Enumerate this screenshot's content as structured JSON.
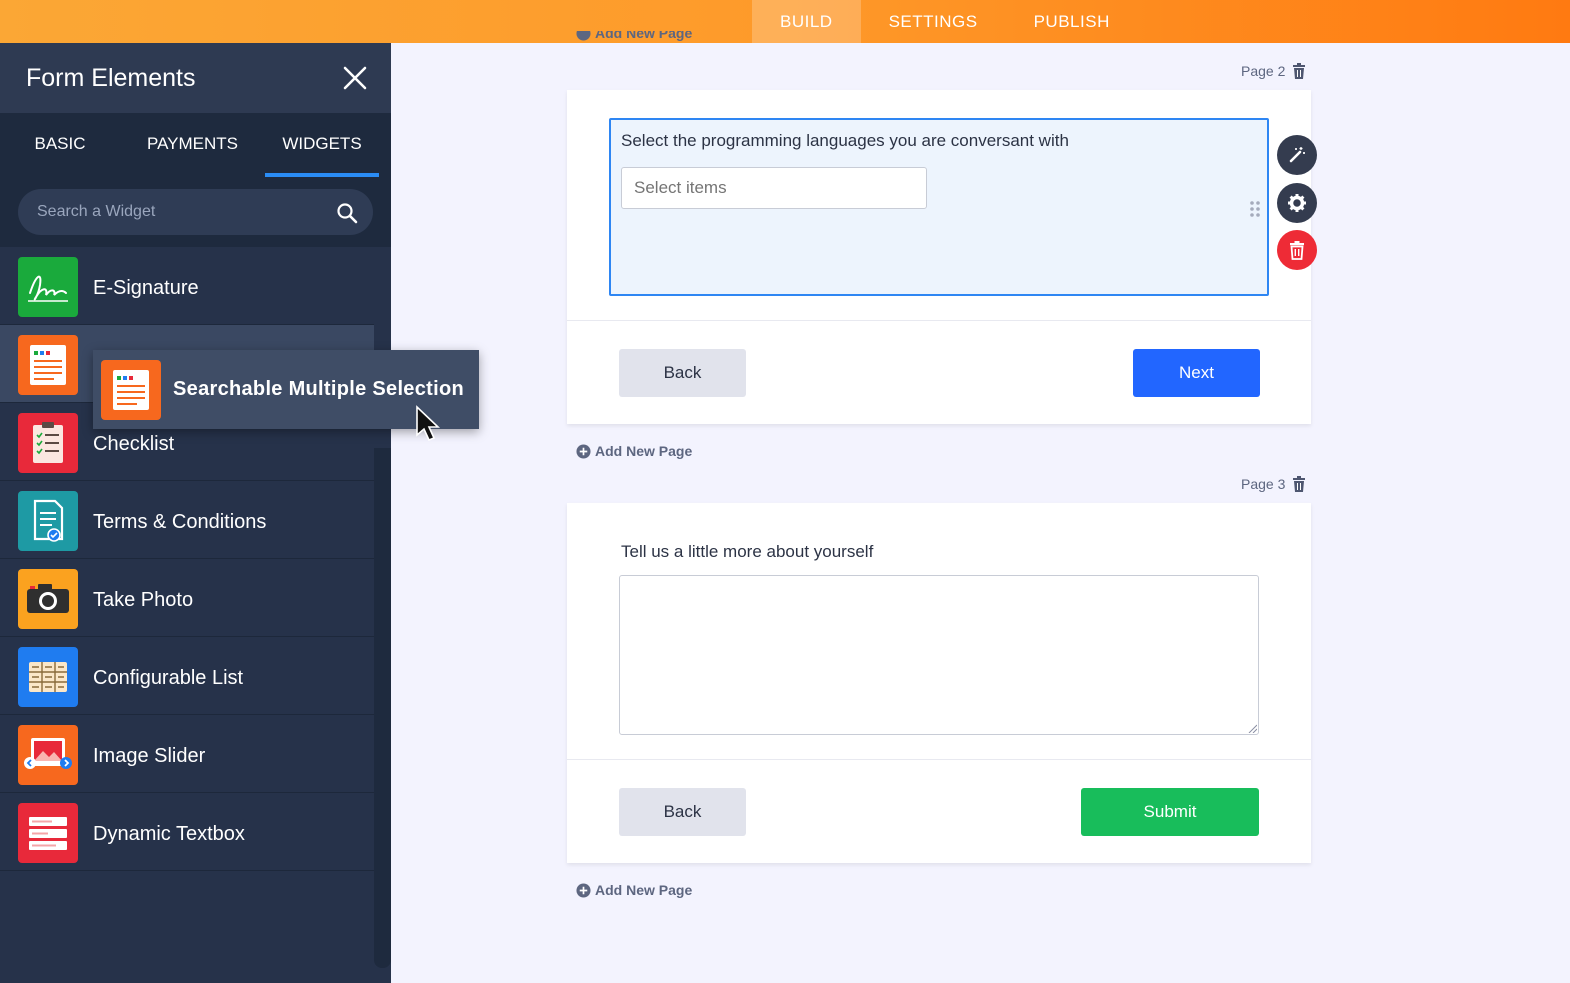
{
  "topnav": {
    "tabs": [
      "BUILD",
      "SETTINGS",
      "PUBLISH"
    ],
    "active": "BUILD"
  },
  "sidebar": {
    "title": "Form Elements",
    "tabs": [
      "BASIC",
      "PAYMENTS",
      "WIDGETS"
    ],
    "active_tab": "WIDGETS",
    "search_placeholder": "Search a Widget",
    "items": [
      {
        "label": "E-Signature",
        "icon": "signature-icon",
        "color": "#1aaa3c"
      },
      {
        "label": "Searchable Multiple Selection",
        "icon": "multiselect-list-icon",
        "color": "#f7681e"
      },
      {
        "label": "Checklist",
        "icon": "clipboard-checklist-icon",
        "color": "#e8293a"
      },
      {
        "label": "Terms & Conditions",
        "icon": "document-check-icon",
        "color": "#1e9aa4"
      },
      {
        "label": "Take Photo",
        "icon": "camera-icon",
        "color": "#fba21f"
      },
      {
        "label": "Configurable List",
        "icon": "table-list-icon",
        "color": "#1f7cf0"
      },
      {
        "label": "Image Slider",
        "icon": "image-slider-icon",
        "color": "#f7681e"
      },
      {
        "label": "Dynamic Textbox",
        "icon": "textbox-icon",
        "color": "#e8293a"
      }
    ]
  },
  "drag_ghost": {
    "label": "Searchable Multiple Selection"
  },
  "canvas": {
    "page2": {
      "label": "Page 2",
      "question": "Select the programming languages you are conversant with",
      "select_placeholder": "Select items",
      "back_label": "Back",
      "next_label": "Next"
    },
    "add_new_page": "Add New Page",
    "page3": {
      "label": "Page 3",
      "question": "Tell us a little more about yourself",
      "back_label": "Back",
      "submit_label": "Submit"
    }
  },
  "colors": {
    "accent": "#2266ff",
    "submit": "#18bd5b",
    "delete": "#ee2b36",
    "field_border": "#2e86f3"
  }
}
